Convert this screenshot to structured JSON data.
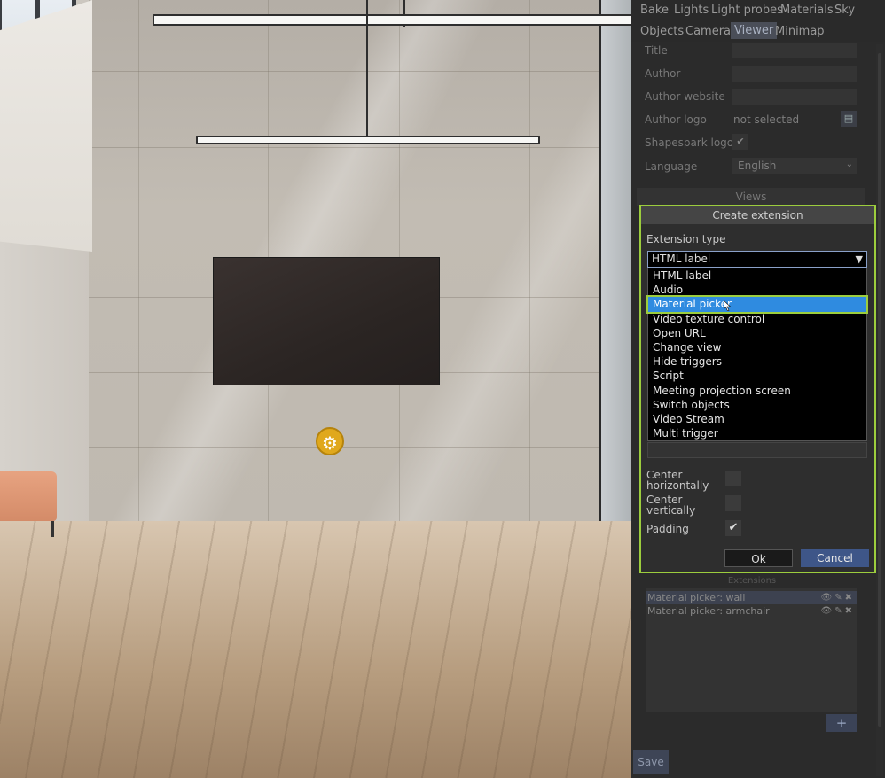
{
  "menu": {
    "row1": [
      "Bake",
      "Lights",
      "Light probes",
      "Materials",
      "Sky"
    ],
    "row2": [
      "Objects",
      "Camera",
      "Viewer",
      "Minimap"
    ],
    "active": "Viewer"
  },
  "viewer_settings": {
    "title_label": "Title",
    "author_label": "Author",
    "author_website_label": "Author website",
    "author_logo_label": "Author logo",
    "author_logo_value": "not selected",
    "shapespark_logo_label": "Shapespark logo",
    "language_label": "Language",
    "language_value": "English",
    "views_label": "Views"
  },
  "dialog": {
    "title": "Create extension",
    "extension_type_label": "Extension type",
    "selected": "HTML label",
    "options": [
      "HTML label",
      "Audio",
      "Material picker",
      "Video texture control",
      "Open URL",
      "Change view",
      "Hide triggers",
      "Script",
      "Meeting projection screen",
      "Switch objects",
      "Video Stream",
      "Multi trigger"
    ],
    "highlighted_option": "Material picker",
    "center_horizontally_label_1": "Center",
    "center_horizontally_label_2": "horizontally",
    "center_vertically_label_1": "Center",
    "center_vertically_label_2": "vertically",
    "padding_label": "Padding",
    "padding_checked": true,
    "ok_label": "Ok",
    "cancel_label": "Cancel"
  },
  "extensions": {
    "header": "Extensions",
    "items": [
      "Material picker: wall",
      "Material picker: armchair"
    ],
    "add_label": "+"
  },
  "save_label": "Save",
  "colors": {
    "highlight_outline": "#9ccd3d",
    "selected_option": "#2f8be0",
    "cancel_button": "#3e5688",
    "gear_marker": "#e0a81c"
  }
}
